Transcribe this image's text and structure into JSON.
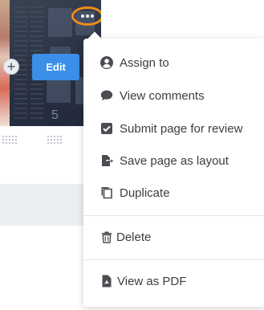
{
  "thumbnail": {
    "page_number": "5",
    "edit_label": "Edit",
    "add_symbol": "+",
    "accent_color": "#3b8fe8",
    "highlight_color": "#f08a1c"
  },
  "menu": {
    "items": [
      {
        "label": "Assign to",
        "icon": "user-circle-icon"
      },
      {
        "label": "View comments",
        "icon": "comment-icon"
      },
      {
        "label": "Submit page for review",
        "icon": "checkbox-icon"
      },
      {
        "label": "Save page as layout",
        "icon": "file-export-icon"
      },
      {
        "label": "Duplicate",
        "icon": "duplicate-icon"
      },
      {
        "label": "Delete",
        "icon": "trash-icon"
      },
      {
        "label": "View as PDF",
        "icon": "pdf-file-icon"
      }
    ]
  }
}
